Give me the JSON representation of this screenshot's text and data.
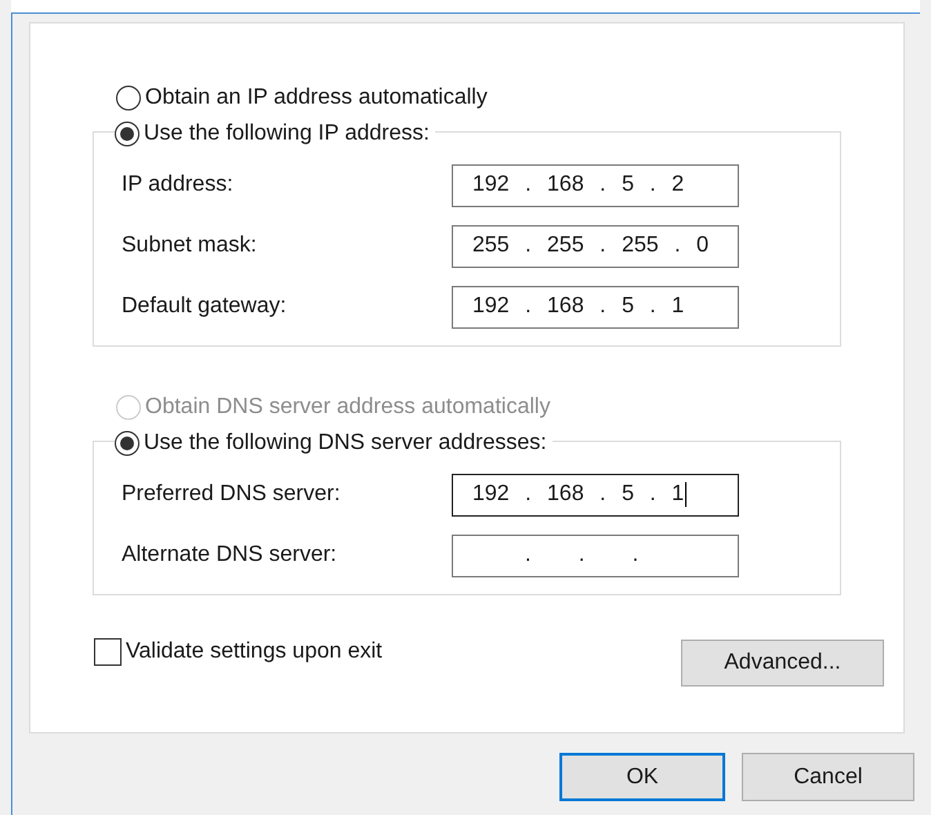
{
  "ip_options": [
    {
      "label": "Obtain an IP address automatically",
      "selected": false,
      "disabled": false
    },
    {
      "label": "Use the following IP address:",
      "selected": true,
      "disabled": false
    }
  ],
  "ip_fields": [
    {
      "label": "IP address:",
      "value": "192 . 168 . 5 . 2",
      "focused": false
    },
    {
      "label": "Subnet mask:",
      "value": "255 . 255 . 255 . 0",
      "focused": false
    },
    {
      "label": "Default gateway:",
      "value": "192 . 168 . 5 . 1",
      "focused": false
    }
  ],
  "dns_options": [
    {
      "label": "Obtain DNS server address automatically",
      "selected": false,
      "disabled": true
    },
    {
      "label": "Use the following DNS server addresses:",
      "selected": true,
      "disabled": false
    }
  ],
  "dns_fields": [
    {
      "label": "Preferred DNS server:",
      "value": "192 . 168 . 5 . 1",
      "focused": true
    },
    {
      "label": "Alternate DNS server:",
      "value": ". . .",
      "focused": false
    }
  ],
  "validate": {
    "label": "Validate settings upon exit",
    "checked": false
  },
  "advanced_button": "Advanced...",
  "buttons": [
    {
      "label": "OK",
      "default": true
    },
    {
      "label": "Cancel",
      "default": false
    }
  ]
}
